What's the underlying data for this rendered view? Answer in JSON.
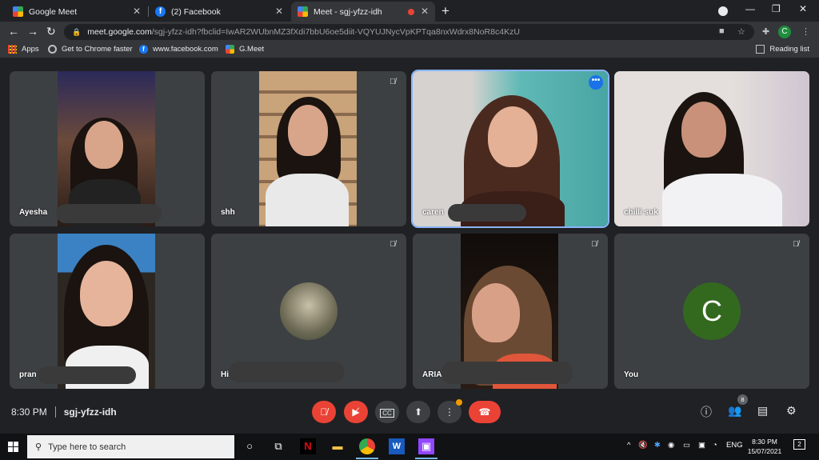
{
  "browser": {
    "tabs": [
      {
        "title": "Google Meet",
        "icon": "meet-icon",
        "active": false
      },
      {
        "title": "(2) Facebook",
        "icon": "facebook-icon",
        "active": false
      },
      {
        "title": "Meet - sgj-yfzz-idh",
        "icon": "meet-icon",
        "active": true
      }
    ],
    "url_host": "meet.google.com",
    "url_path": "/sgj-yfzz-idh?fbclid=IwAR2WUbnMZ3fXdi7bbU6oe5diit-VQYUJNycVpKPTqa8nxWdrx8NoR8c4KzU",
    "profile_initial": "C",
    "bookmarks": [
      {
        "label": "Apps",
        "icon": "apps-grid-icon"
      },
      {
        "label": "Get to Chrome faster",
        "icon": "globe-icon"
      },
      {
        "label": "www.facebook.com",
        "icon": "facebook-icon"
      },
      {
        "label": "G.Meet",
        "icon": "meet-icon"
      }
    ],
    "reading_list": "Reading list"
  },
  "meet": {
    "participants": [
      {
        "name": "Ayesha",
        "muted": false
      },
      {
        "name": "shh",
        "muted": true
      },
      {
        "name": "caren",
        "muted": false,
        "speaking": true
      },
      {
        "name": "chilli suk",
        "muted": false
      },
      {
        "name": "pran",
        "muted": true
      },
      {
        "name": "Hil",
        "muted": true
      },
      {
        "name": "ARIA",
        "muted": true
      },
      {
        "name": "You",
        "muted": true,
        "avatar_initial": "C"
      }
    ],
    "time": "8:30 PM",
    "meeting_code": "sgj-yfzz-idh",
    "people_count": "8",
    "colors": {
      "accent": "#8ab4f8",
      "red": "#ea4335",
      "tile": "#3c4043",
      "avatar": "#33691e"
    }
  },
  "taskbar": {
    "search_placeholder": "Type here to search",
    "language": "ENG",
    "clock_time": "8:30 PM",
    "clock_date": "15/07/2021",
    "notification_count": "2"
  }
}
